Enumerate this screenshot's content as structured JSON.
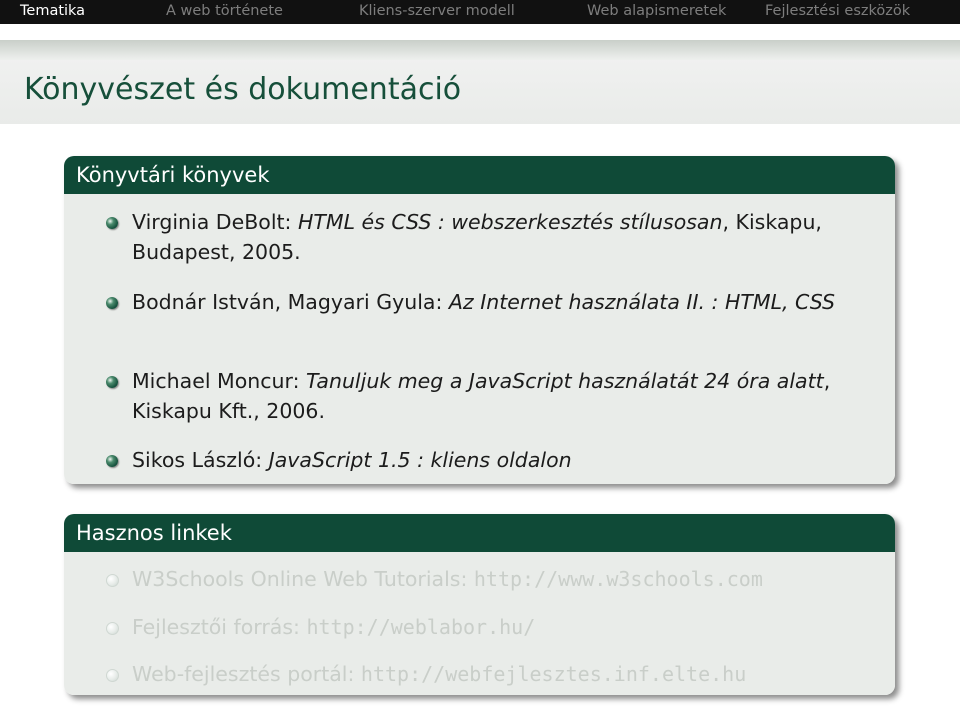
{
  "nav": {
    "items": [
      {
        "label": "Tematika",
        "active": true
      },
      {
        "label": "A web története",
        "active": false
      },
      {
        "label": "Kliens-szerver modell",
        "active": false
      },
      {
        "label": "Web alapismeretek",
        "active": false
      },
      {
        "label": "Fejlesztési eszközök",
        "active": false
      }
    ]
  },
  "frame_title": "Könyvészet és dokumentáció",
  "books_block": {
    "title": "Könyvtári könyvek",
    "items": [
      {
        "prefix": "Virginia DeBolt: ",
        "italic": "HTML és CSS : webszerkesztés stílusosan",
        "suffix": ", Kiskapu, Budapest, 2005."
      },
      {
        "prefix": "Bodnár István, Magyari Gyula: ",
        "italic": "Az Internet használata II. : HTML, CSS",
        "suffix": ""
      },
      {
        "prefix": "Michael Moncur: ",
        "italic": "Tanuljuk meg a JavaScript használatát 24 óra alatt",
        "suffix": ", Kiskapu Kft., 2006."
      },
      {
        "prefix": "Sikos László: ",
        "italic": "JavaScript 1.5 : kliens oldalon",
        "suffix": ""
      }
    ]
  },
  "links_block": {
    "title": "Hasznos linkek",
    "items": [
      {
        "label": "W3Schools Online Web Tutorials: ",
        "url": "http://www.w3schools.com"
      },
      {
        "label": "Fejlesztői forrás: ",
        "url": "http://weblabor.hu/"
      },
      {
        "label": "Web-fejlesztés portál: ",
        "url": "http://webfejlesztes.inf.elte.hu"
      }
    ]
  },
  "colors": {
    "navbar_bg": "#111111",
    "nav_active": "#ffffff",
    "nav_inactive": "#7d7d7d",
    "title_color": "#164f3a",
    "block_head_bg": "#0f4a37",
    "block_body_bg": "#e9ece9"
  }
}
